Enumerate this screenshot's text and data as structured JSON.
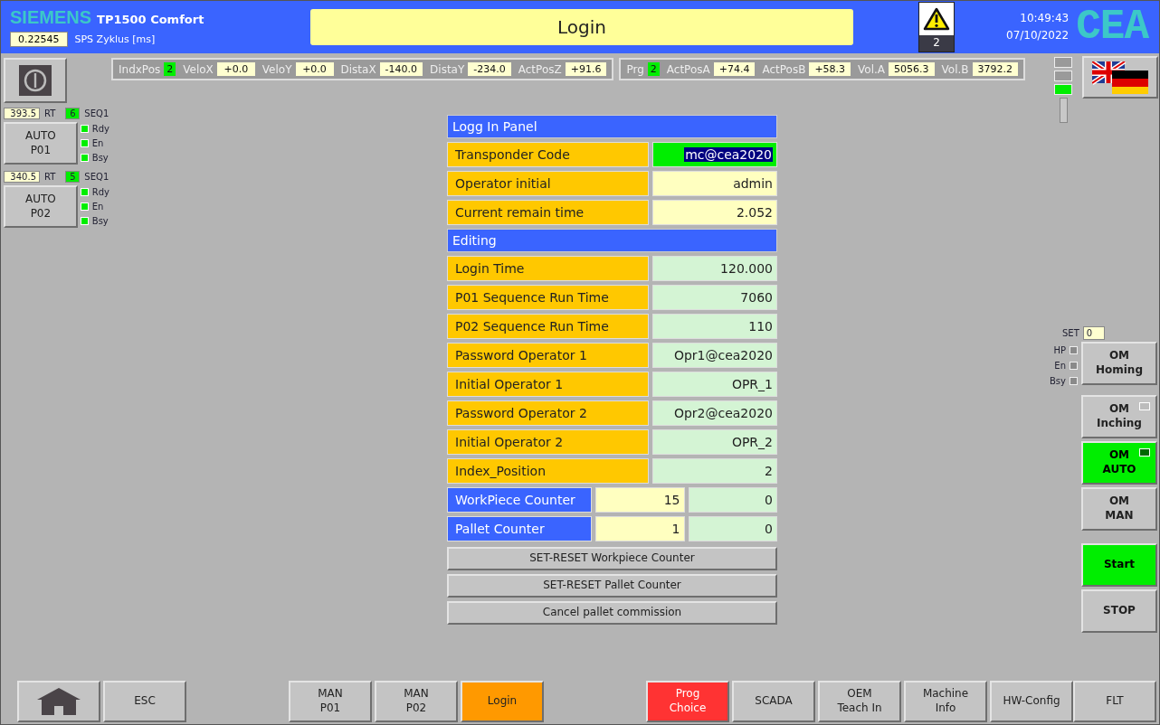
{
  "header": {
    "brand": "SIEMENS",
    "model": "TP1500 Comfort",
    "cycle_value": "0.22545",
    "cycle_label": "SPS Zyklus [ms]",
    "title": "Login",
    "alarm_count": "2",
    "time": "10:49:43",
    "date": "07/10/2022",
    "logo": "CEA"
  },
  "status_groups": [
    [
      {
        "label": "IndxPos",
        "value": "2",
        "kind": "index"
      },
      {
        "label": "VeloX",
        "value": "+0.0",
        "kind": "value"
      },
      {
        "label": "VeloY",
        "value": "+0.0",
        "kind": "value"
      },
      {
        "label": "DistaX",
        "value": "-140.0",
        "kind": "value"
      },
      {
        "label": "DistaY",
        "value": "-234.0",
        "kind": "value"
      },
      {
        "label": "ActPosZ",
        "value": "+91.6",
        "kind": "value"
      }
    ],
    [
      {
        "label": "Prg",
        "value": "2",
        "kind": "index"
      },
      {
        "label": "ActPosA",
        "value": "+74.4",
        "kind": "value"
      },
      {
        "label": "ActPosB",
        "value": "+58.3",
        "kind": "value"
      },
      {
        "label": "Vol.A",
        "value": "5056.3",
        "kind": "value"
      },
      {
        "label": "Vol.B",
        "value": "3792.2",
        "kind": "value"
      }
    ]
  ],
  "stations": [
    {
      "runtime": "393.5",
      "rt_label": "RT",
      "seq": "6",
      "seq_label": "SEQ1",
      "button": "AUTO\nP01",
      "indicators": [
        {
          "label": "Rdy",
          "on": true
        },
        {
          "label": "En",
          "on": true
        },
        {
          "label": "Bsy",
          "on": true
        }
      ]
    },
    {
      "runtime": "340.5",
      "rt_label": "RT",
      "seq": "5",
      "seq_label": "SEQ1",
      "button": "AUTO\nP02",
      "indicators": [
        {
          "label": "Rdy",
          "on": true
        },
        {
          "label": "En",
          "on": true
        },
        {
          "label": "Bsy",
          "on": true
        }
      ]
    }
  ],
  "tower_lamps": [
    {
      "on": false
    },
    {
      "on": false
    },
    {
      "on": true
    }
  ],
  "panel": [
    {
      "title": "Logg In Panel",
      "rows": [
        {
          "label": "Transponder Code",
          "kind": "parameter",
          "fields": [
            {
              "value": "mc@cea2020",
              "kind": "active"
            }
          ]
        },
        {
          "label": "Operator initial",
          "kind": "parameter",
          "fields": [
            {
              "value": "admin",
              "kind": "readonly"
            }
          ]
        },
        {
          "label": "Current remain time",
          "kind": "parameter",
          "fields": [
            {
              "value": "2.052",
              "kind": "readonly"
            }
          ]
        }
      ]
    },
    {
      "title": "Editing",
      "rows": [
        {
          "label": "Login Time",
          "kind": "parameter",
          "fields": [
            {
              "value": "120.000",
              "kind": "editable"
            }
          ]
        },
        {
          "label": "P01 Sequence Run Time",
          "kind": "parameter",
          "fields": [
            {
              "value": "7060",
              "kind": "editable"
            }
          ]
        },
        {
          "label": "P02 Sequence Run Time",
          "kind": "parameter",
          "fields": [
            {
              "value": "110",
              "kind": "editable"
            }
          ]
        },
        {
          "label": "Password Operator 1",
          "kind": "parameter",
          "fields": [
            {
              "value": "Opr1@cea2020",
              "kind": "editable"
            }
          ]
        },
        {
          "label": "Initial Operator 1",
          "kind": "parameter",
          "fields": [
            {
              "value": "OPR_1",
              "kind": "editable"
            }
          ]
        },
        {
          "label": "Password Operator 2",
          "kind": "parameter",
          "fields": [
            {
              "value": "Opr2@cea2020",
              "kind": "editable"
            }
          ]
        },
        {
          "label": "Initial Operator 2",
          "kind": "parameter",
          "fields": [
            {
              "value": "OPR_2",
              "kind": "editable"
            }
          ]
        },
        {
          "label": "Index_Position",
          "kind": "parameter",
          "fields": [
            {
              "value": "2",
              "kind": "editable"
            }
          ]
        },
        {
          "label": "WorkPiece Counter",
          "kind": "counter",
          "fields": [
            {
              "value": "15",
              "kind": "readonly"
            },
            {
              "value": "0",
              "kind": "editable"
            }
          ]
        },
        {
          "label": "Pallet Counter",
          "kind": "counter",
          "fields": [
            {
              "value": "1",
              "kind": "readonly"
            },
            {
              "value": "0",
              "kind": "editable"
            }
          ]
        }
      ]
    }
  ],
  "panel_buttons": [
    "SET-RESET Workpiece Counter",
    "SET-RESET Pallet Counter",
    "Cancel pallet commission"
  ],
  "right": {
    "set_label": "SET",
    "set_value": "0",
    "indicators": [
      {
        "label": "HP",
        "on": false
      },
      {
        "label": "En",
        "on": false
      },
      {
        "label": "Bsy",
        "on": false
      }
    ],
    "modes": [
      {
        "label": "OM\nHoming",
        "selected": false,
        "lamp": false
      },
      {
        "label": "OM\nInching",
        "selected": false,
        "lamp": true
      },
      {
        "label": "OM\nAUTO",
        "selected": true,
        "lamp": true
      },
      {
        "label": "OM\nMAN",
        "selected": false,
        "lamp": false
      }
    ],
    "controls": [
      {
        "label": "Start",
        "on": true
      },
      {
        "label": "STOP",
        "on": false
      }
    ]
  },
  "footer": [
    [
      {
        "kind": "home"
      },
      {
        "kind": "text",
        "label": "ESC"
      }
    ],
    [
      {
        "kind": "text",
        "label": "MAN\nP01"
      },
      {
        "kind": "text",
        "label": "MAN\nP02"
      },
      {
        "kind": "text",
        "label": "Login",
        "color": "#ff9900"
      }
    ],
    [
      {
        "kind": "text",
        "label": "Prog\nChoice",
        "color": "#ff3333"
      },
      {
        "kind": "text",
        "label": "SCADA"
      },
      {
        "kind": "text",
        "label": "OEM\nTeach In"
      },
      {
        "kind": "text",
        "label": "Machine\nInfo"
      },
      {
        "kind": "text",
        "label": "HW-Config"
      }
    ],
    [
      {
        "kind": "text",
        "label": "FLT"
      }
    ]
  ]
}
